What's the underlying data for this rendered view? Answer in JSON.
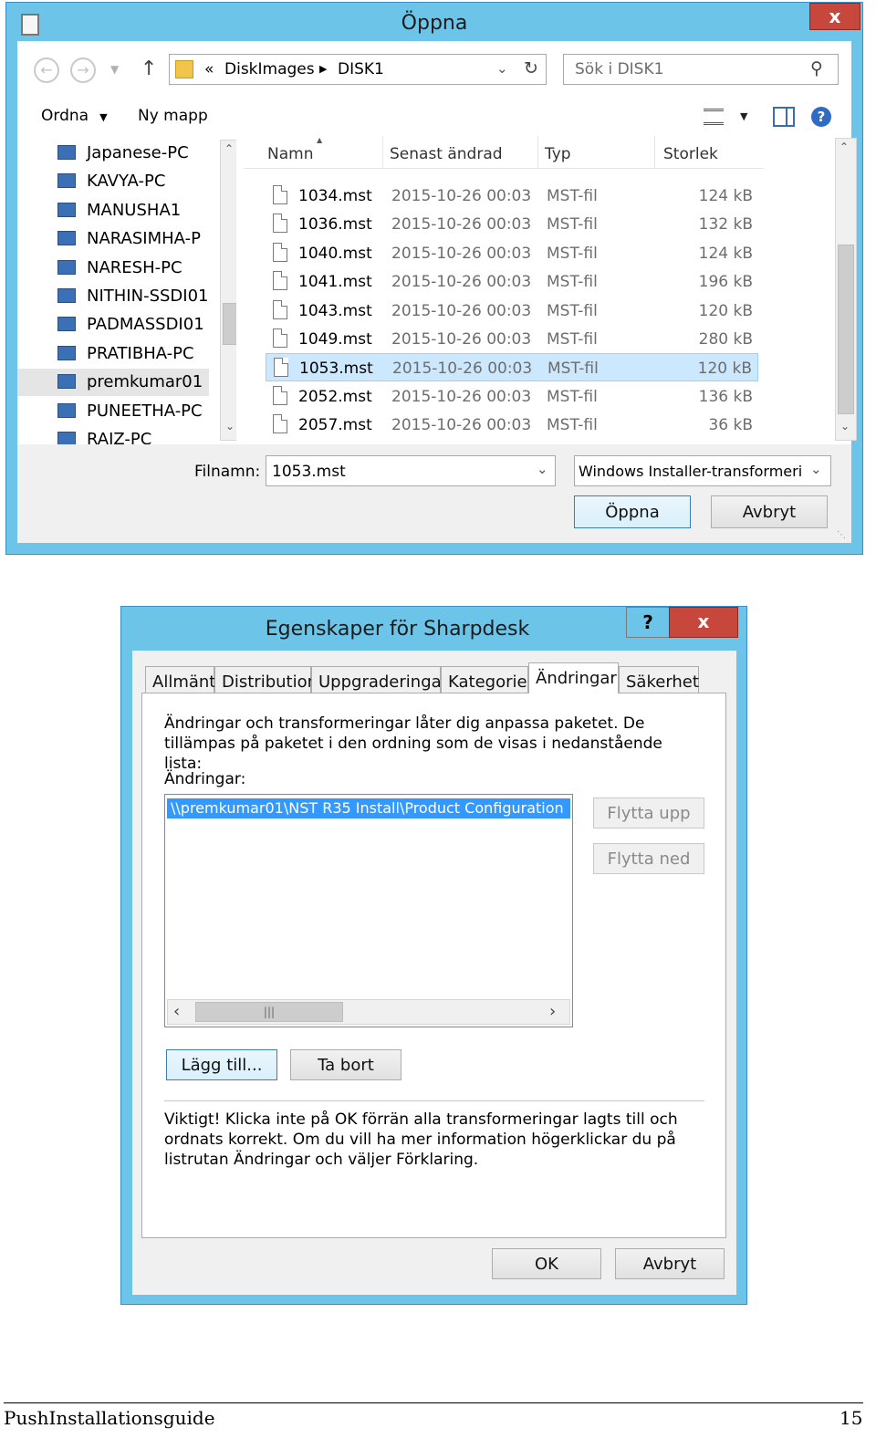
{
  "open_dialog": {
    "title": "Öppna",
    "close": "x",
    "breadcrumb": {
      "prefix": "«",
      "items": [
        "DiskImages",
        "DISK1"
      ]
    },
    "search_placeholder": "Sök i DISK1",
    "toolbar": {
      "organize": "Ordna",
      "new_folder": "Ny mapp"
    },
    "nav_items": [
      "Japanese-PC",
      "KAVYA-PC",
      "MANUSHA1",
      "NARASIMHA-P",
      "NARESH-PC",
      "NITHIN-SSDI01",
      "PADMASSDI01",
      "PRATIBHA-PC",
      "premkumar01",
      "PUNEETHA-PC",
      "RAJZ-PC"
    ],
    "selected_nav": "premkumar01",
    "columns": {
      "name": "Namn",
      "modified": "Senast ändrad",
      "type": "Typ",
      "size": "Storlek"
    },
    "files": [
      {
        "name": "1034.mst",
        "modified": "2015-10-26 00:03",
        "type": "MST-fil",
        "size": "124 kB"
      },
      {
        "name": "1036.mst",
        "modified": "2015-10-26 00:03",
        "type": "MST-fil",
        "size": "132 kB"
      },
      {
        "name": "1040.mst",
        "modified": "2015-10-26 00:03",
        "type": "MST-fil",
        "size": "124 kB"
      },
      {
        "name": "1041.mst",
        "modified": "2015-10-26 00:03",
        "type": "MST-fil",
        "size": "196 kB"
      },
      {
        "name": "1043.mst",
        "modified": "2015-10-26 00:03",
        "type": "MST-fil",
        "size": "120 kB"
      },
      {
        "name": "1049.mst",
        "modified": "2015-10-26 00:03",
        "type": "MST-fil",
        "size": "280 kB"
      },
      {
        "name": "1053.mst",
        "modified": "2015-10-26 00:03",
        "type": "MST-fil",
        "size": "120 kB"
      },
      {
        "name": "2052.mst",
        "modified": "2015-10-26 00:03",
        "type": "MST-fil",
        "size": "136 kB"
      },
      {
        "name": "2057.mst",
        "modified": "2015-10-26 00:03",
        "type": "MST-fil",
        "size": "36 kB"
      }
    ],
    "selected_file": "1053.mst",
    "filename_label": "Filnamn:",
    "filename_value": "1053.mst",
    "filter_value": "Windows Installer-transformeri",
    "open_button": "Öppna",
    "cancel_button": "Avbryt"
  },
  "props_dialog": {
    "title": "Egenskaper för Sharpdesk",
    "help": "?",
    "close": "x",
    "tabs": [
      "Allmänt",
      "Distribution",
      "Uppgraderingar",
      "Kategorier",
      "Ändringar",
      "Säkerhet"
    ],
    "active_tab": "Ändringar",
    "description": "Ändringar och transformeringar låter dig anpassa paketet. De tillämpas på paketet i den ordning som de visas i nedanstående lista:",
    "list_label": "Ändringar:",
    "list_item": "\\\\premkumar01\\NST R35 Install\\Product Configuration",
    "move_up": "Flytta upp",
    "move_down": "Flytta ned",
    "add": "Lägg till...",
    "remove": "Ta bort",
    "note": "Viktigt! Klicka inte på OK förrän alla transformeringar lagts till och ordnats korrekt. Om du vill ha mer information högerklickar du på listrutan Ändringar och väljer Förklaring.",
    "ok": "OK",
    "cancel": "Avbryt"
  },
  "footer": {
    "guide": "PushInstallationsguide",
    "page": "15"
  },
  "colors": {
    "frame": "#6cc5e8",
    "selection": "#cce8ff",
    "close_red": "#c7473d",
    "list_selection": "#3399ff"
  }
}
